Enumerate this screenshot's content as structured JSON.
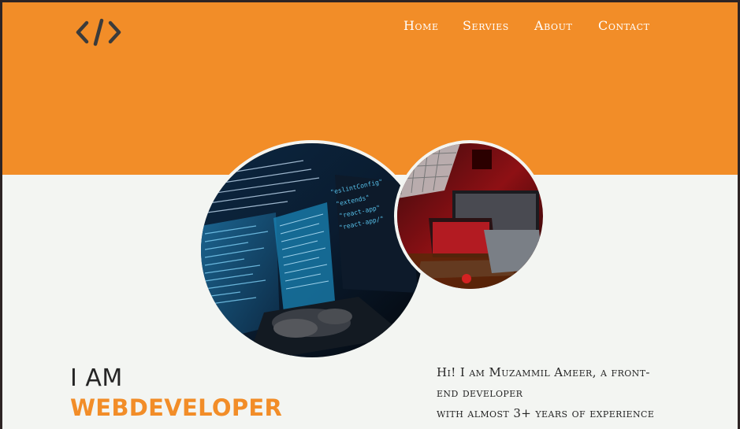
{
  "header": {
    "logo_icon": "code-brackets-icon",
    "nav": [
      {
        "label": "Home"
      },
      {
        "label": "Servies"
      },
      {
        "label": "About"
      },
      {
        "label": "Contact"
      }
    ]
  },
  "hero": {
    "heading_line1": "I AM",
    "heading_line2": "WEBDEVELOPER",
    "bio_line1": "Hi! I am Muzammil Ameer, a front-",
    "bio_line2": "end developer",
    "bio_line3": "with almost 3+ years of experience"
  },
  "colors": {
    "accent": "#f28d28",
    "background": "#f3f5f2",
    "text": "#252525",
    "frame": "#2d2424"
  }
}
